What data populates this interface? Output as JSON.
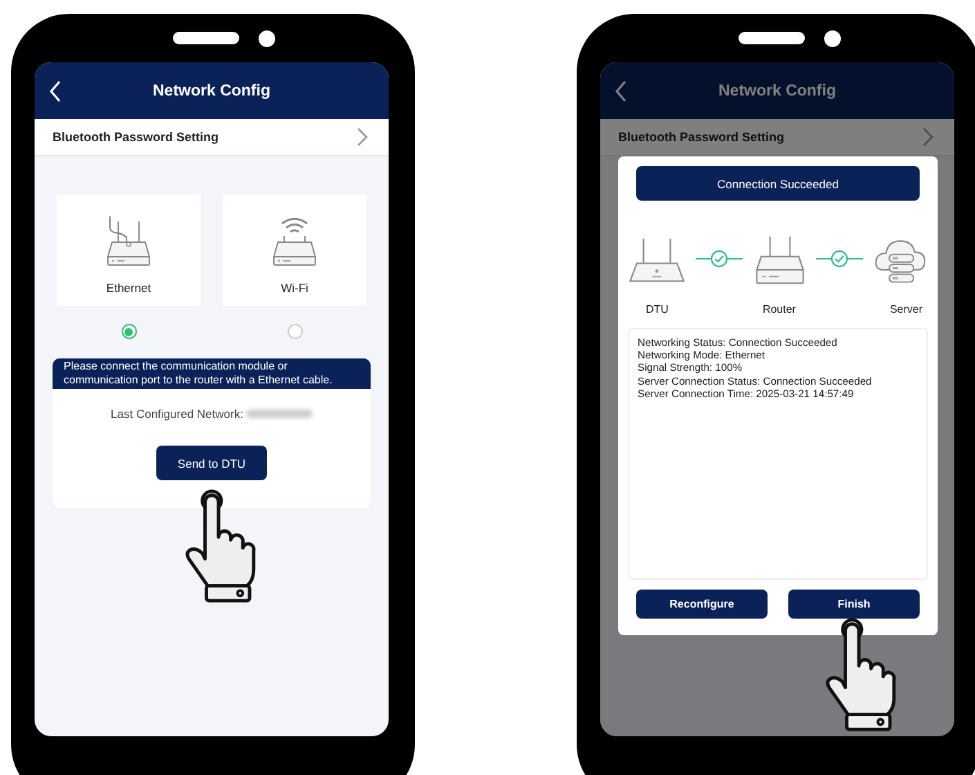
{
  "config_screen": {
    "header": {
      "title": "Network Config"
    },
    "settings_row": {
      "label": "Bluetooth Password Setting"
    },
    "options": [
      {
        "kind": "ethernet",
        "label": "Ethernet",
        "selected": true
      },
      {
        "kind": "wifi",
        "label": "Wi-Fi",
        "selected": false
      }
    ],
    "notice": "Please connect the communication module or communication port to the router with a Ethernet cable.",
    "last_network_label": "Last Configured Network:",
    "send_button": "Send to DTU"
  },
  "result_screen": {
    "header": {
      "title": "Network Config"
    },
    "settings_row": {
      "label": "Bluetooth Password Setting"
    },
    "dialog": {
      "title": "Connection Succeeded",
      "nodes": [
        {
          "kind": "dtu",
          "label": "DTU"
        },
        {
          "kind": "router",
          "label": "Router"
        },
        {
          "kind": "server",
          "label": "Server"
        }
      ],
      "status_lines": [
        "Networking Status: Connection Succeeded",
        "Networking Mode: Ethernet",
        "Signal Strength: 100%",
        "Server Connection Status: Connection Succeeded",
        "Server Connection Time: 2025-03-21 14:57:49"
      ],
      "buttons": [
        "Reconfigure",
        "Finish"
      ]
    }
  }
}
